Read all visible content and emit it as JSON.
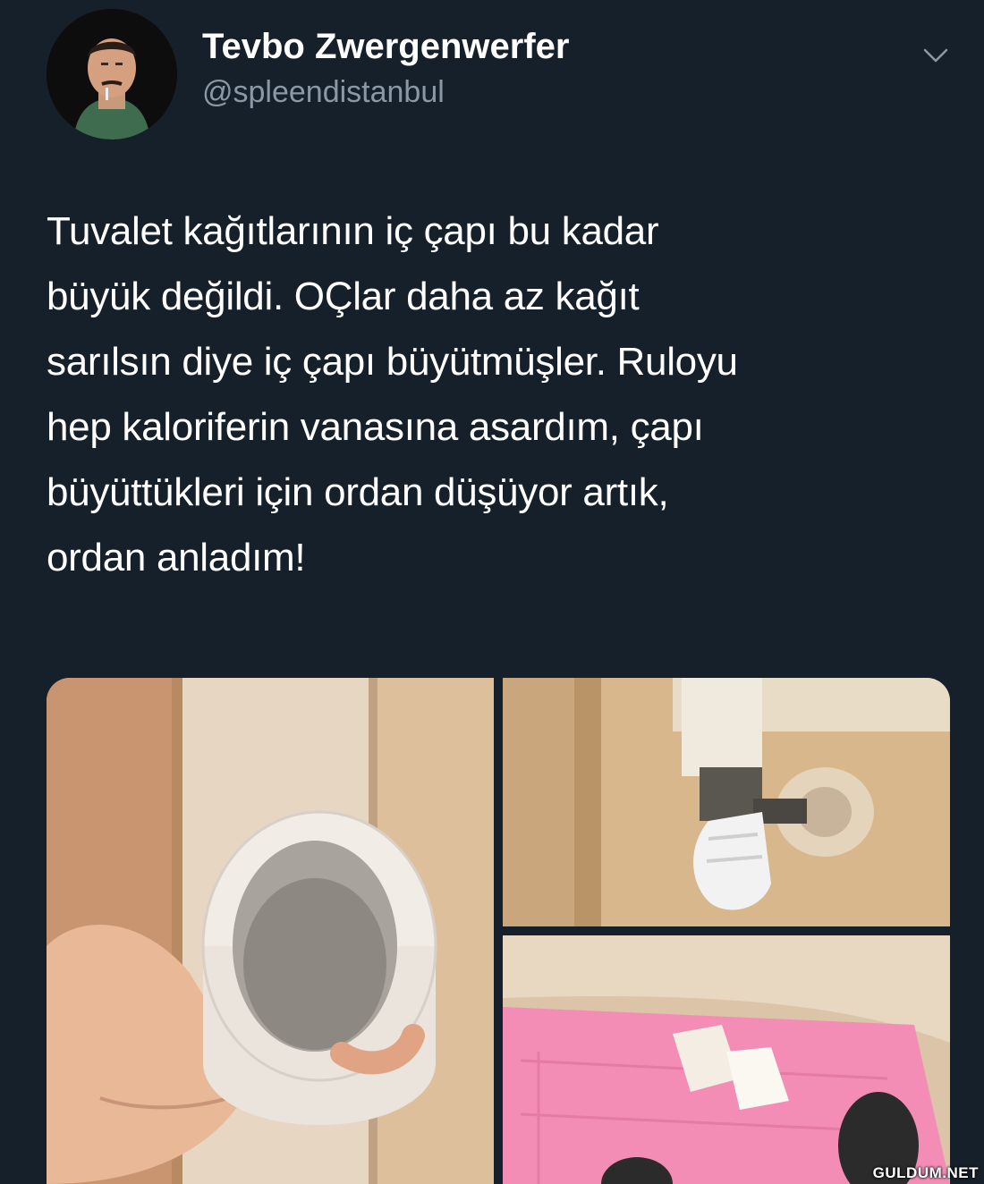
{
  "tweet": {
    "author": {
      "display_name": "Tevbo Zwergenwerfer",
      "handle": "@spleendistanbul"
    },
    "text_lines": [
      "Tuvalet kağıtlarının iç çapı bu kadar",
      "büyük değildi. OÇlar daha az kağıt",
      "sarılsın diye iç çapı büyütmüşler. Ruloyu",
      "hep kaloriferin vanasına asardım, çapı",
      "büyüttükleri için ordan düşüyor artık,",
      "ordan anladım!"
    ],
    "menu_icon": "chevron-down-icon",
    "photos": [
      {
        "name": "hand-holding-toilet-roll-core"
      },
      {
        "name": "radiator-valve"
      },
      {
        "name": "roll-on-pink-bath-mat"
      }
    ]
  },
  "watermark": "GULDUM.NET",
  "colors": {
    "background": "#15202b",
    "secondary_text": "#8b98a5",
    "primary_text": "#ffffff"
  }
}
